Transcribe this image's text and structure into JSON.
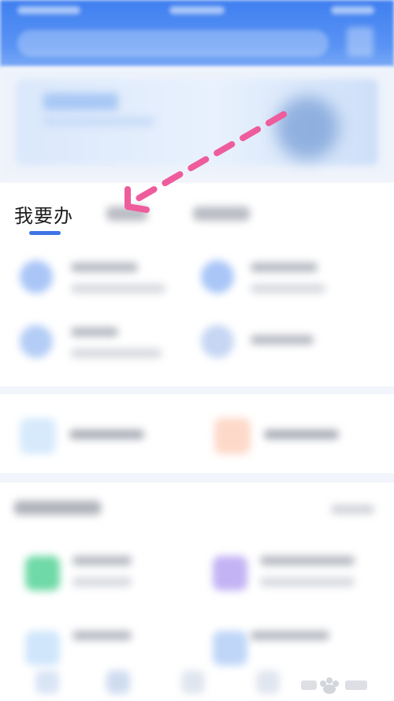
{
  "tabs": {
    "active_label": "我要办"
  },
  "colors": {
    "header_blue": "#3f7ff0",
    "tab_underline": "#3e74e6",
    "annotation_arrow": "#ee5c9c"
  },
  "annotation": {
    "arrow_icon": "dashed-arrow-icon"
  }
}
